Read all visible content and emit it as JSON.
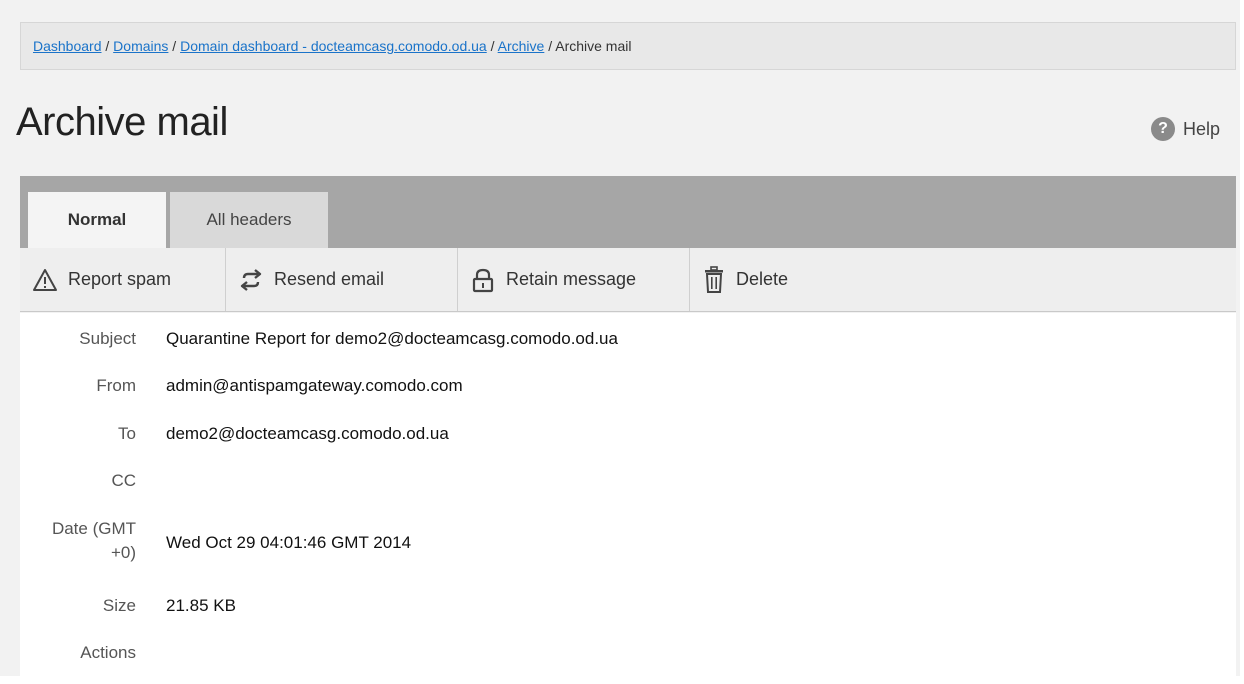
{
  "breadcrumb": {
    "items": [
      {
        "label": "Dashboard",
        "link": true
      },
      {
        "label": "Domains",
        "link": true
      },
      {
        "label": "Domain dashboard - docteamcasg.comodo.od.ua",
        "link": true
      },
      {
        "label": "Archive",
        "link": true
      },
      {
        "label": "Archive mail",
        "link": false
      }
    ],
    "separator": " / "
  },
  "page_title": "Archive mail",
  "help": {
    "label": "Help",
    "icon": "question-circle-icon"
  },
  "tabs": [
    {
      "label": "Normal",
      "active": true
    },
    {
      "label": "All headers",
      "active": false
    }
  ],
  "toolbar": {
    "report_spam": {
      "label": "Report spam",
      "icon": "warning-icon"
    },
    "resend_email": {
      "label": "Resend email",
      "icon": "resend-icon"
    },
    "retain_message": {
      "label": "Retain message",
      "icon": "lock-icon"
    },
    "delete": {
      "label": "Delete",
      "icon": "trash-icon"
    }
  },
  "details": {
    "subject": {
      "label": "Subject",
      "value": "Quarantine Report for demo2@docteamcasg.comodo.od.ua"
    },
    "from": {
      "label": "From",
      "value": "admin@antispamgateway.comodo.com"
    },
    "to": {
      "label": "To",
      "value": "demo2@docteamcasg.comodo.od.ua"
    },
    "cc": {
      "label": "CC",
      "value": ""
    },
    "date": {
      "label_line1": "Date (GMT",
      "label_line2": "+0)",
      "value": "Wed Oct 29 04:01:46 GMT 2014"
    },
    "size": {
      "label": "Size",
      "value": "21.85 KB"
    },
    "actions": {
      "label": "Actions",
      "value": ""
    }
  },
  "colors": {
    "link": "#1a73c9",
    "tab_bar": "#a6a6a6",
    "page_bg": "#f2f2f2"
  }
}
